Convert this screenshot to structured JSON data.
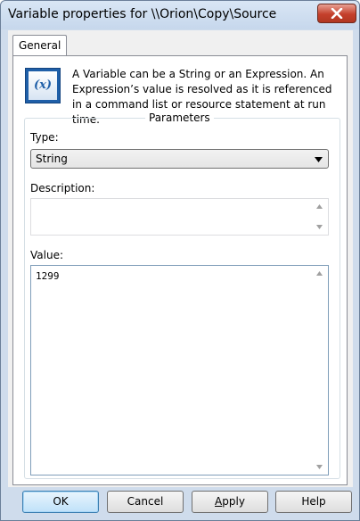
{
  "window": {
    "title": "Variable properties for \\\\Orion\\Copy\\Source"
  },
  "tabs": [
    {
      "label": "General",
      "selected": true
    }
  ],
  "info": {
    "icon": "variable-x-icon",
    "icon_text": "(x)",
    "description": "A Variable can be a String or an Expression. An Expression’s value is resolved as it is referenced in a command list or resource statement at run time."
  },
  "parameters": {
    "legend": "Parameters",
    "type_label": "Type:",
    "type_value": "String",
    "description_label": "Description:",
    "description_value": "",
    "value_label": "Value:",
    "value_text": "1299"
  },
  "buttons": {
    "ok": "OK",
    "cancel": "Cancel",
    "apply_first": "A",
    "apply_rest": "pply",
    "help": "Help"
  },
  "colors": {
    "title_bg": "#c6d7ec",
    "close_red": "#c4402c",
    "default_button": "#bfe1f9"
  }
}
